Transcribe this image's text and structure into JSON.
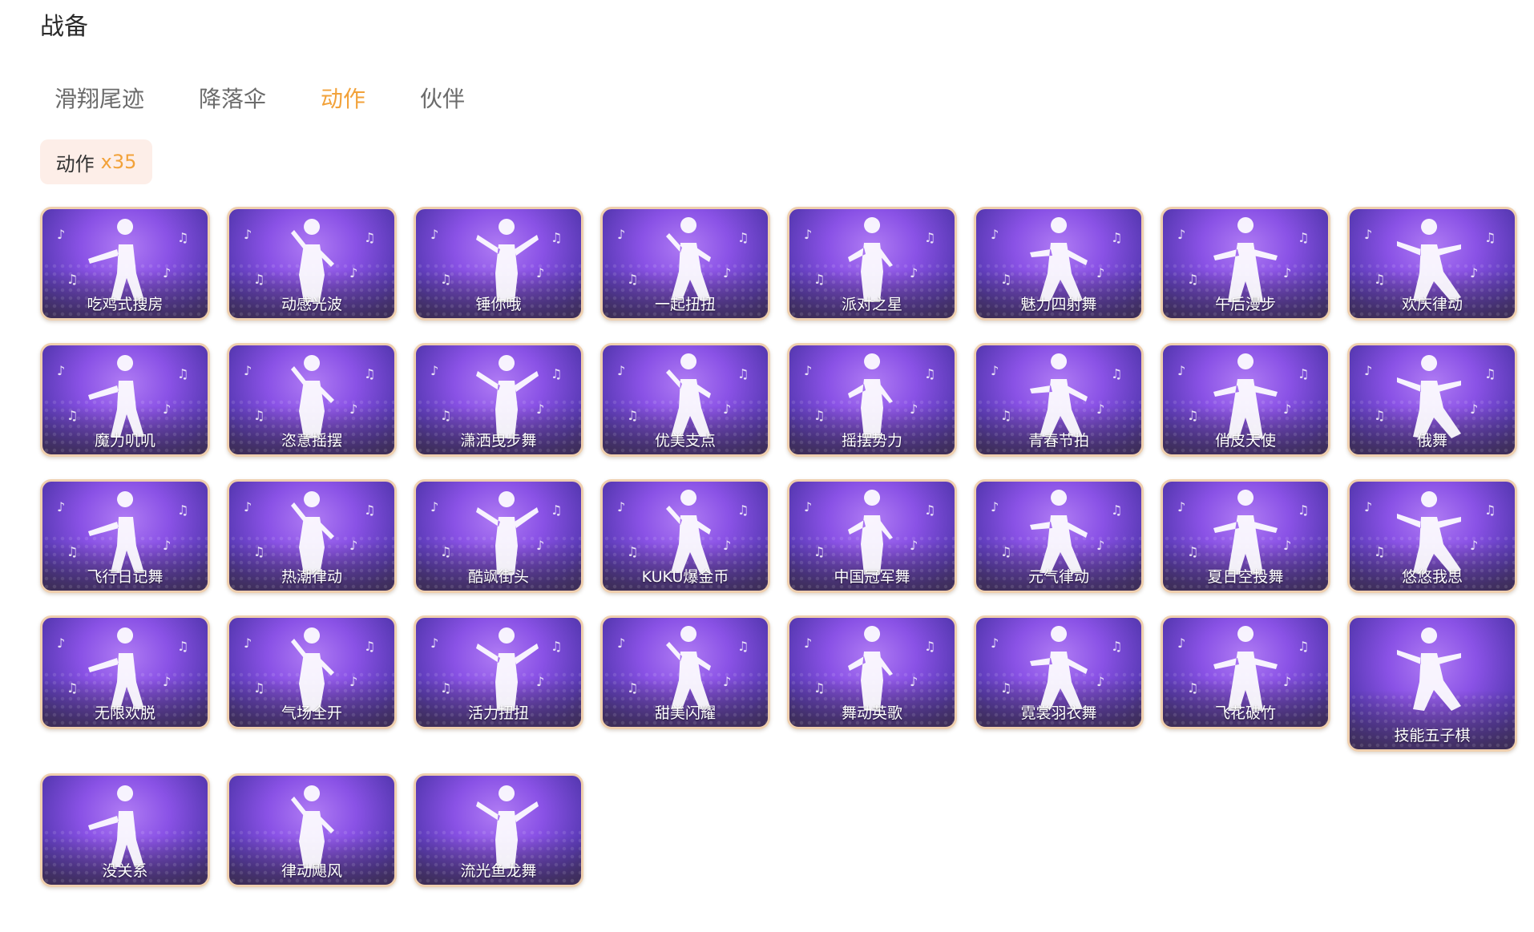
{
  "page_title": "战备",
  "tabs": [
    {
      "label": "滑翔尾迹",
      "active": false
    },
    {
      "label": "降落伞",
      "active": false
    },
    {
      "label": "动作",
      "active": true
    },
    {
      "label": "伙伴",
      "active": false
    }
  ],
  "badge": {
    "label": "动作",
    "count": "x35"
  },
  "colors": {
    "accent": "#f2a23a",
    "card_border": "#efcfae",
    "card_purple": "#8a52e6"
  },
  "items": [
    "吃鸡式搜房",
    "动感光波",
    "锤你哦",
    "一起扭扭",
    "派对之星",
    "魅力四射舞",
    "午后漫步",
    "欢庆律动",
    "魔力叽叽",
    "恣意摇摆",
    "潇洒曳步舞",
    "优美支点",
    "摇摆势力",
    "青春节拍",
    "俏皮天使",
    "俄舞",
    "飞行日记舞",
    "热潮律动",
    "酷飒街头",
    "KUKU爆金币",
    "中国冠军舞",
    "元气律动",
    "夏日空投舞",
    "悠悠我思",
    "无限欢脱",
    "气场全开",
    "活力扭扭",
    "甜美闪耀",
    "舞动英歌",
    "霓裳羽衣舞",
    "飞花破竹",
    "技能五子棋",
    "没关系",
    "律动飓风",
    "流光鱼龙舞"
  ]
}
